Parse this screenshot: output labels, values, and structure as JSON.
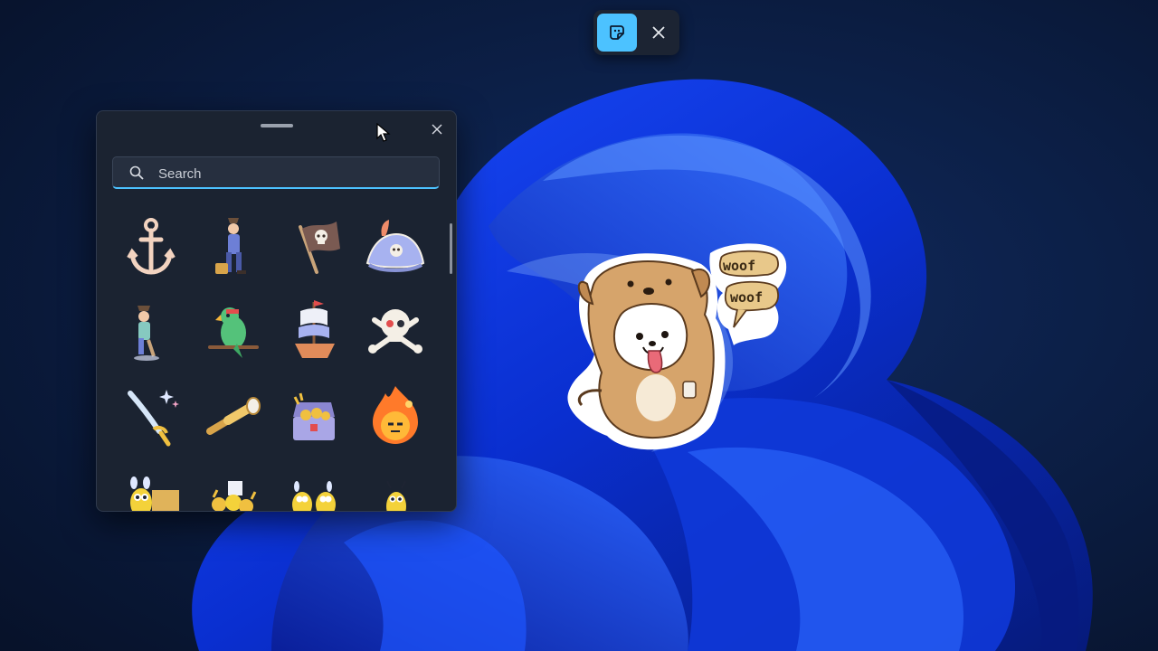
{
  "top_toolbar": {
    "sticker_button_icon": "sticker-icon",
    "close_icon": "close-icon",
    "accent_color": "#4cc2ff"
  },
  "picker": {
    "search": {
      "placeholder": "Search",
      "value": ""
    },
    "close_icon": "close-icon",
    "stickers": [
      {
        "name": "anchor"
      },
      {
        "name": "pirate-captain"
      },
      {
        "name": "pirate-flag"
      },
      {
        "name": "pirate-hat"
      },
      {
        "name": "pirate-peg-leg"
      },
      {
        "name": "parrot"
      },
      {
        "name": "pirate-ship"
      },
      {
        "name": "skull-crossbones"
      },
      {
        "name": "cutlass"
      },
      {
        "name": "spyglass"
      },
      {
        "name": "treasure-chest"
      },
      {
        "name": "fire-bomb"
      },
      {
        "name": "bee-with-crates"
      },
      {
        "name": "bee-coins"
      },
      {
        "name": "bee-pair"
      },
      {
        "name": "bee-standing"
      }
    ]
  },
  "desktop": {
    "placed_sticker": {
      "name": "dog-costume-sticker",
      "bubble_top": "woof",
      "bubble_bottom": "woof"
    }
  }
}
